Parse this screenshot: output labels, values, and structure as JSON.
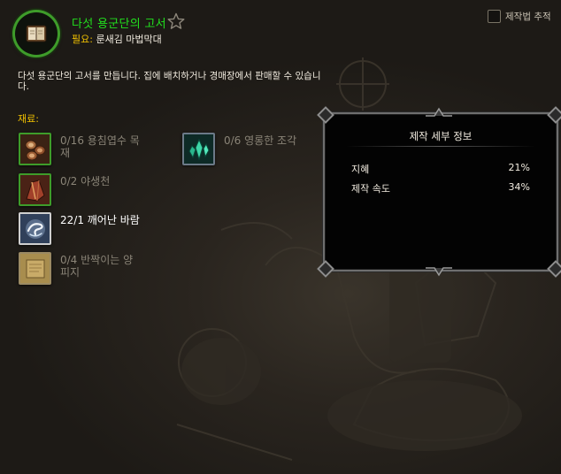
{
  "recipe": {
    "title": "다섯 용군단의 고서",
    "icon": "book-icon",
    "requirement_label": "필요:",
    "requirement_value": "룬새김 마법막대",
    "description": "다섯 용군단의 고서를 만듭니다. 집에 배치하거나 경매장에서 판매할 수 있습니다.",
    "favorite_icon": "star-outline-icon"
  },
  "track": {
    "label": "제작법 추적",
    "checked": false
  },
  "materials_label": "재료:",
  "reagents": [
    {
      "text": "0/16 용침엽수 목재",
      "icon": "logs-icon",
      "owned": false
    },
    {
      "text": "0/2 야생천",
      "icon": "cloth-icon",
      "owned": false
    },
    {
      "text": "22/1 깨어난 바람",
      "icon": "wind-icon",
      "owned": true
    },
    {
      "text": "0/4 반짝이는 양피지",
      "icon": "parchment-icon",
      "owned": false
    },
    {
      "text": "0/6 영롱한 조각",
      "icon": "crystal-shard-icon",
      "owned": false
    }
  ],
  "details": {
    "title": "제작 세부 정보",
    "stats": [
      {
        "label": "지혜",
        "value": "21%"
      },
      {
        "label": "제작 속도",
        "value": "34%"
      }
    ]
  },
  "colors": {
    "title_green": "#22e01e",
    "label_gold": "#f0c000",
    "quality_border_green": "#3e9c2a"
  }
}
